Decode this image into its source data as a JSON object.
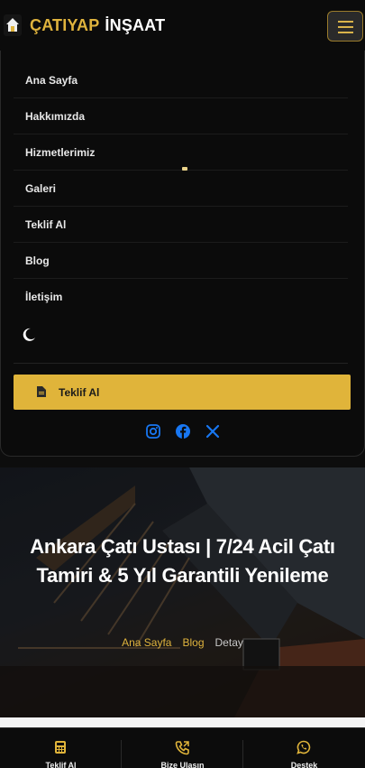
{
  "brand": {
    "name_gold": "ÇATIYAP",
    "name_white": "İNŞAAT"
  },
  "nav": {
    "items": [
      {
        "label": "Ana Sayfa"
      },
      {
        "label": "Hakkımızda"
      },
      {
        "label": "Hizmetlerimiz"
      },
      {
        "label": "Galeri"
      },
      {
        "label": "Teklif Al"
      },
      {
        "label": "Blog"
      },
      {
        "label": "İletişim"
      }
    ],
    "cta_label": "Teklif Al",
    "social": [
      "instagram-icon",
      "facebook-icon",
      "x-twitter-icon"
    ]
  },
  "hero": {
    "title": "Ankara Çatı Ustası | 7/24 Acil Çatı Tamiri & 5 Yıl Garantili Yenileme",
    "breadcrumbs": [
      "Ana Sayfa",
      "Blog",
      "Detay"
    ]
  },
  "bottom_bar": {
    "items": [
      {
        "label": "Teklif Al",
        "icon": "calculator-icon"
      },
      {
        "label": "Bize Ulaşın",
        "icon": "phone-icon"
      },
      {
        "label": "Destek",
        "icon": "whatsapp-icon"
      }
    ]
  },
  "colors": {
    "accent": "#e0b43a",
    "background": "#0b0b0b",
    "social_blue": "#1877f2"
  }
}
